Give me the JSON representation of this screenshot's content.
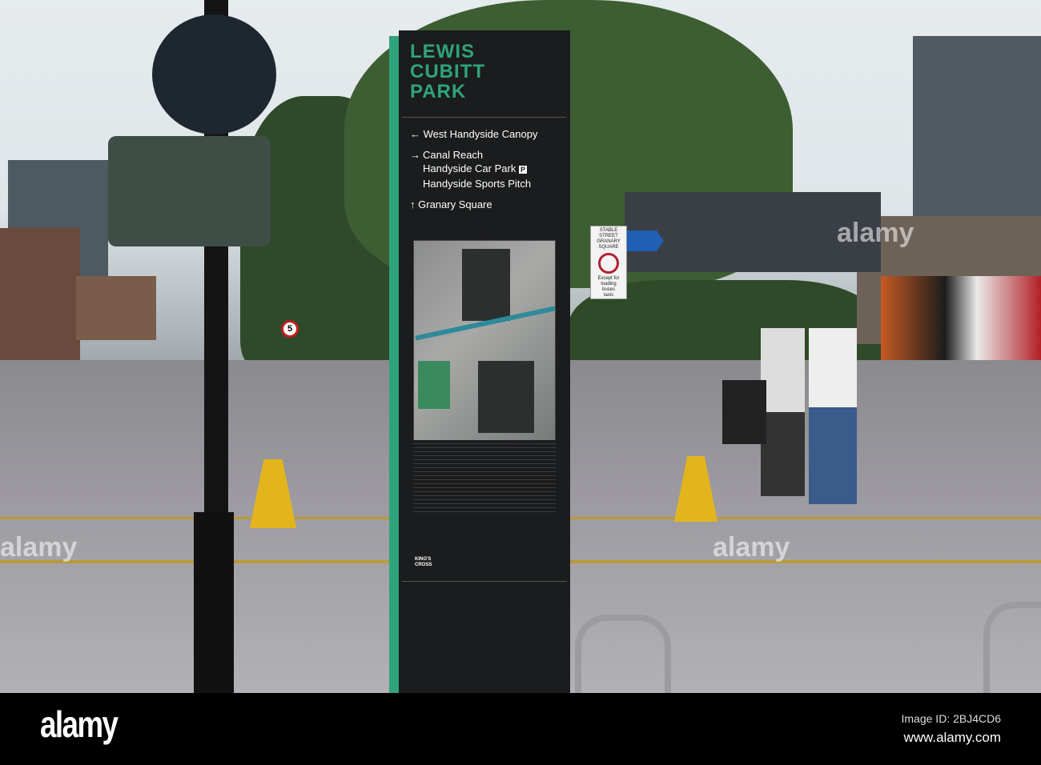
{
  "sign": {
    "title_lines": [
      "LEWIS",
      "CUBITT",
      "PARK"
    ],
    "directions": [
      {
        "arrow": "←",
        "lines": [
          "West Handyside Canopy"
        ]
      },
      {
        "arrow": "→",
        "lines": [
          "Canal Reach",
          "Handyside Car Park",
          "Handyside Sports Pitch"
        ]
      },
      {
        "arrow": "↑",
        "lines": [
          "Granary Square"
        ]
      }
    ],
    "parking_badge": "P",
    "brand": "KING'S CROSS",
    "accent": "#2fa37a"
  },
  "street_sign": {
    "lines": [
      "STABLE",
      "STREET",
      "GRANARY",
      "SQUARE"
    ],
    "exception": [
      "Except for",
      "loading",
      "buses",
      "taxis"
    ]
  },
  "speed_sign": "5",
  "watermark": {
    "logo": "alamy",
    "image_id": "Image ID: 2BJ4CD6",
    "url": "www.alamy.com"
  }
}
